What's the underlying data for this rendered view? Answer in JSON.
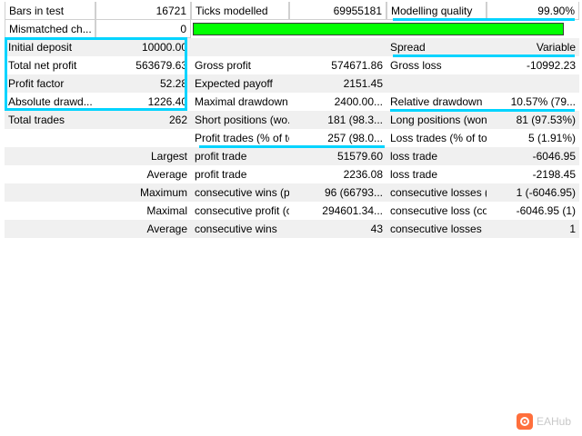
{
  "rows": [
    {
      "c": [
        "Bars in test",
        "16721",
        "Ticks modelled",
        "69955181",
        "Modelling quality",
        "99.90%"
      ]
    },
    {
      "c": [
        "Mismatched ch...",
        "0"
      ],
      "bar": {
        "fill": 1.0,
        "color": "#00ff00"
      }
    },
    {
      "c": [
        "Initial deposit",
        "10000.00",
        "",
        "",
        "Spread",
        "Variable"
      ]
    },
    {
      "c": [
        "Total net profit",
        "563679.63",
        "Gross profit",
        "574671.86",
        "Gross loss",
        "-10992.23"
      ]
    },
    {
      "c": [
        "Profit factor",
        "52.28",
        "Expected payoff",
        "2151.45",
        "",
        ""
      ]
    },
    {
      "c": [
        "Absolute drawd...",
        "1226.40",
        "Maximal drawdown",
        "2400.00...",
        "Relative drawdown",
        "10.57% (79..."
      ]
    },
    {
      "c": [
        "Total trades",
        "262",
        "Short positions (wo...",
        "181 (98.3...",
        "Long positions (won...",
        "81 (97.53%)"
      ]
    },
    {
      "c": [
        "",
        "",
        "Profit trades (% of to...",
        "257 (98.0...",
        "Loss trades (% of tot...",
        "5 (1.91%)"
      ]
    },
    {
      "c": [
        "",
        "Largest",
        "profit trade",
        "51579.60",
        "loss trade",
        "-6046.95"
      ]
    },
    {
      "c": [
        "",
        "Average",
        "profit trade",
        "2236.08",
        "loss trade",
        "-2198.45"
      ]
    },
    {
      "c": [
        "",
        "Maximum",
        "consecutive wins (pr...",
        "96 (66793...",
        "consecutive losses (l...",
        "1 (-6046.95)"
      ]
    },
    {
      "c": [
        "",
        "Maximal",
        "consecutive profit (c...",
        "294601.34...",
        "consecutive loss (co...",
        "-6046.95 (1)"
      ]
    },
    {
      "c": [
        "",
        "Average",
        "consecutive wins",
        "43",
        "consecutive losses",
        "1"
      ]
    }
  ],
  "highlight_color": "#00d4ff",
  "watermark": {
    "text": "EAHub",
    "icon": "eahub-logo-icon"
  }
}
